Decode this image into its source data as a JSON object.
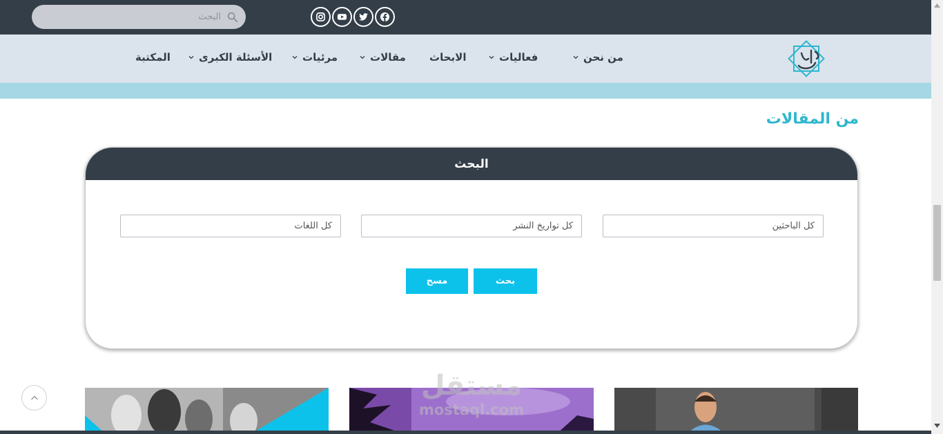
{
  "header": {
    "search_placeholder": "البحث",
    "social": [
      "facebook-icon",
      "twitter-icon",
      "youtube-icon",
      "instagram-icon"
    ]
  },
  "nav": {
    "items": [
      {
        "label": "من نحن",
        "dropdown": true
      },
      {
        "label": "فعاليات",
        "dropdown": true
      },
      {
        "label": "الابحاث",
        "dropdown": false
      },
      {
        "label": "مقالات",
        "dropdown": true
      },
      {
        "label": "مرئيات",
        "dropdown": true
      },
      {
        "label": "الأسئلة الكبرى",
        "dropdown": true
      },
      {
        "label": "المكتبة",
        "dropdown": false
      }
    ]
  },
  "page": {
    "section_title": "من المقالات"
  },
  "search_panel": {
    "title": "البحث",
    "filters": {
      "researchers": "كل الباحثين",
      "dates": "كل تواريخ النشر",
      "languages": "كل اللغات"
    },
    "search_button": "بحث",
    "clear_button": "مسح"
  },
  "watermark": {
    "arabic": "مستقل",
    "latin": "mostaql.com"
  },
  "colors": {
    "dark": "#333e48",
    "nav_bg": "#dbe3ec",
    "accent": "#0dc2ea",
    "title": "#2fb6cf"
  }
}
